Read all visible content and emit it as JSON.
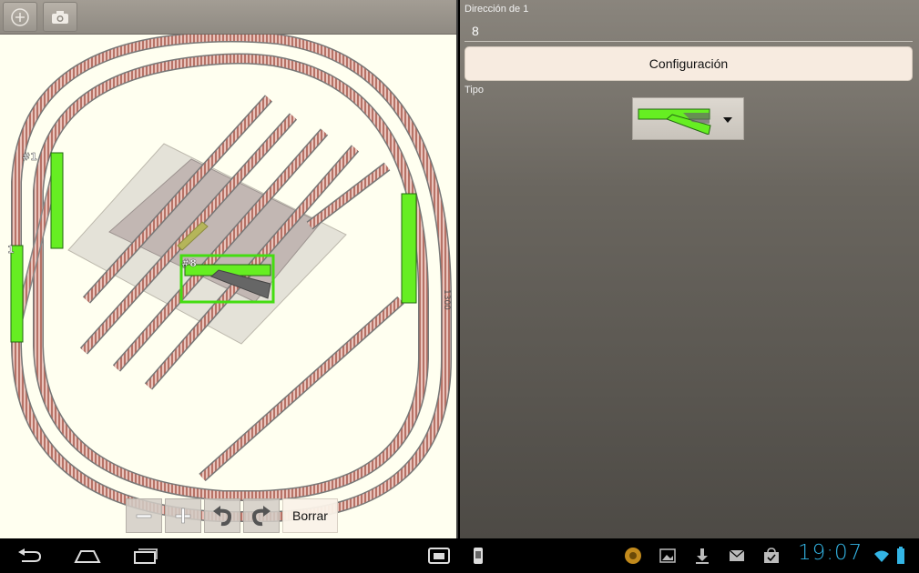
{
  "toolbar": {
    "add_icon": "add-circle-icon",
    "camera_icon": "camera-icon"
  },
  "layout": {
    "labels": {
      "turnout_a": "#1",
      "turnout_b": "1",
      "selected": "#8",
      "dimension": "1300"
    }
  },
  "zoom_bar": {
    "minus_icon": "minus-icon",
    "plus_icon": "plus-icon",
    "undo_icon": "undo-icon",
    "redo_icon": "redo-icon",
    "borrar_label": "Borrar"
  },
  "properties": {
    "address_label": "Dirección de 1",
    "address_value": "8",
    "config_button_label": "Configuración",
    "type_label": "Tipo",
    "type_icon": "turnout-right-icon"
  },
  "navbar": {
    "clock": "19:07",
    "icons": [
      "back-icon",
      "home-icon",
      "recent-apps-icon",
      "screenshot-icon",
      "usb-icon",
      "app-notification-icon",
      "gallery-icon",
      "download-icon",
      "mail-icon",
      "store-icon",
      "wifi-icon",
      "battery-icon"
    ]
  },
  "colors": {
    "track_tie": "#c7867a",
    "track_rail": "#777777",
    "turnout_green": "#66ee22",
    "accent": "#33b5e5",
    "canvas_bg": "#fffff0"
  }
}
